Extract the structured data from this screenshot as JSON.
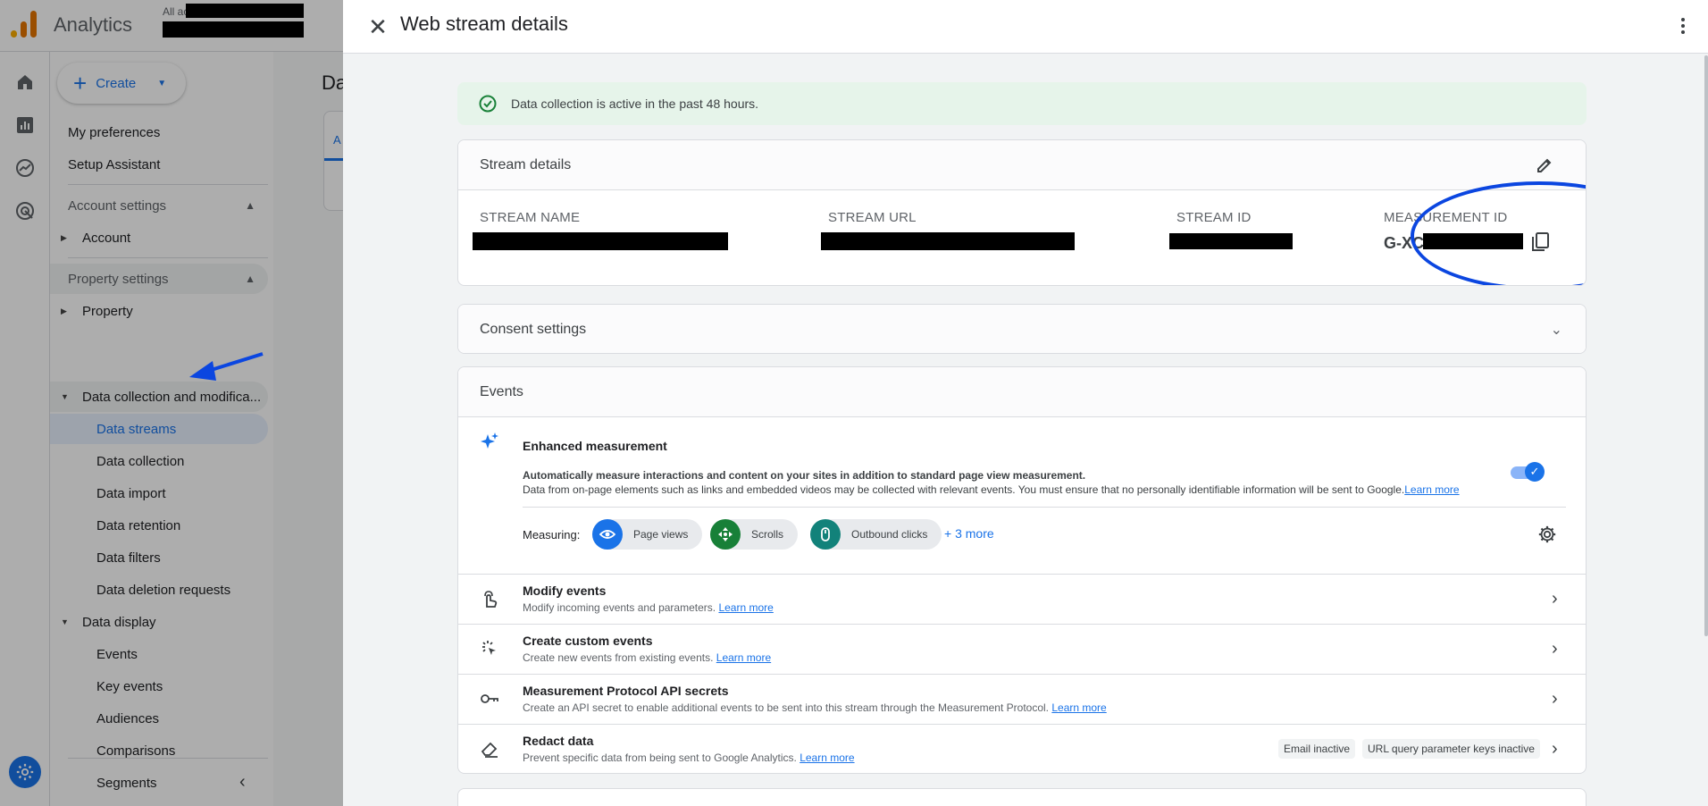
{
  "app": {
    "name": "Analytics",
    "account_prefix": "All ac"
  },
  "sidebar": {
    "create_label": "Create",
    "items": [
      {
        "label": "My preferences"
      },
      {
        "label": "Setup Assistant"
      },
      {
        "label": "Account settings"
      },
      {
        "label": "Account"
      },
      {
        "label": "Property settings"
      },
      {
        "label": "Property"
      },
      {
        "label": "Data collection and modifica..."
      },
      {
        "label": "Data streams"
      },
      {
        "label": "Data collection"
      },
      {
        "label": "Data import"
      },
      {
        "label": "Data retention"
      },
      {
        "label": "Data filters"
      },
      {
        "label": "Data deletion requests"
      },
      {
        "label": "Data display"
      },
      {
        "label": "Events"
      },
      {
        "label": "Key events"
      },
      {
        "label": "Audiences"
      },
      {
        "label": "Comparisons"
      },
      {
        "label": "Segments"
      }
    ]
  },
  "main": {
    "title": "Da",
    "tab": "A"
  },
  "panel": {
    "title": "Web stream details",
    "banner": "Data collection is active in the past 48 hours.",
    "stream_details": {
      "heading": "Stream details",
      "stream_name_label": "STREAM NAME",
      "stream_url_label": "STREAM URL",
      "stream_id_label": "STREAM ID",
      "measurement_id_label": "MEASUREMENT ID",
      "measurement_id_value": "G-XC"
    },
    "consent": {
      "heading": "Consent settings"
    },
    "events": {
      "heading": "Events",
      "enhanced": {
        "title": "Enhanced measurement",
        "desc1": "Automatically measure interactions and content on your sites in addition to standard page view measurement.",
        "desc2": "Data from on-page elements such as links and embedded videos may be collected with relevant events. You must ensure that no personally identifiable information will be sent to Google.",
        "learn_more": "Learn more",
        "toggle_on": true,
        "measuring_label": "Measuring:",
        "chips": [
          "Page views",
          "Scrolls",
          "Outbound clicks"
        ],
        "more": "+ 3 more"
      },
      "rows": [
        {
          "title": "Modify events",
          "desc": "Modify incoming events and parameters.",
          "learn_more": "Learn more"
        },
        {
          "title": "Create custom events",
          "desc": "Create new events from existing events.",
          "learn_more": "Learn more"
        },
        {
          "title": "Measurement Protocol API secrets",
          "desc": "Create an API secret to enable additional events to be sent into this stream through the Measurement Protocol.",
          "learn_more": "Learn more"
        },
        {
          "title": "Redact data",
          "desc": "Prevent specific data from being sent to Google Analytics.",
          "learn_more": "Learn more",
          "badges": [
            "Email inactive",
            "URL query parameter keys inactive"
          ]
        }
      ]
    }
  },
  "colors": {
    "accent": "#1a73e8",
    "annotation": "#0b46e0",
    "banner_bg": "#e6f4ea",
    "success": "#188038"
  }
}
